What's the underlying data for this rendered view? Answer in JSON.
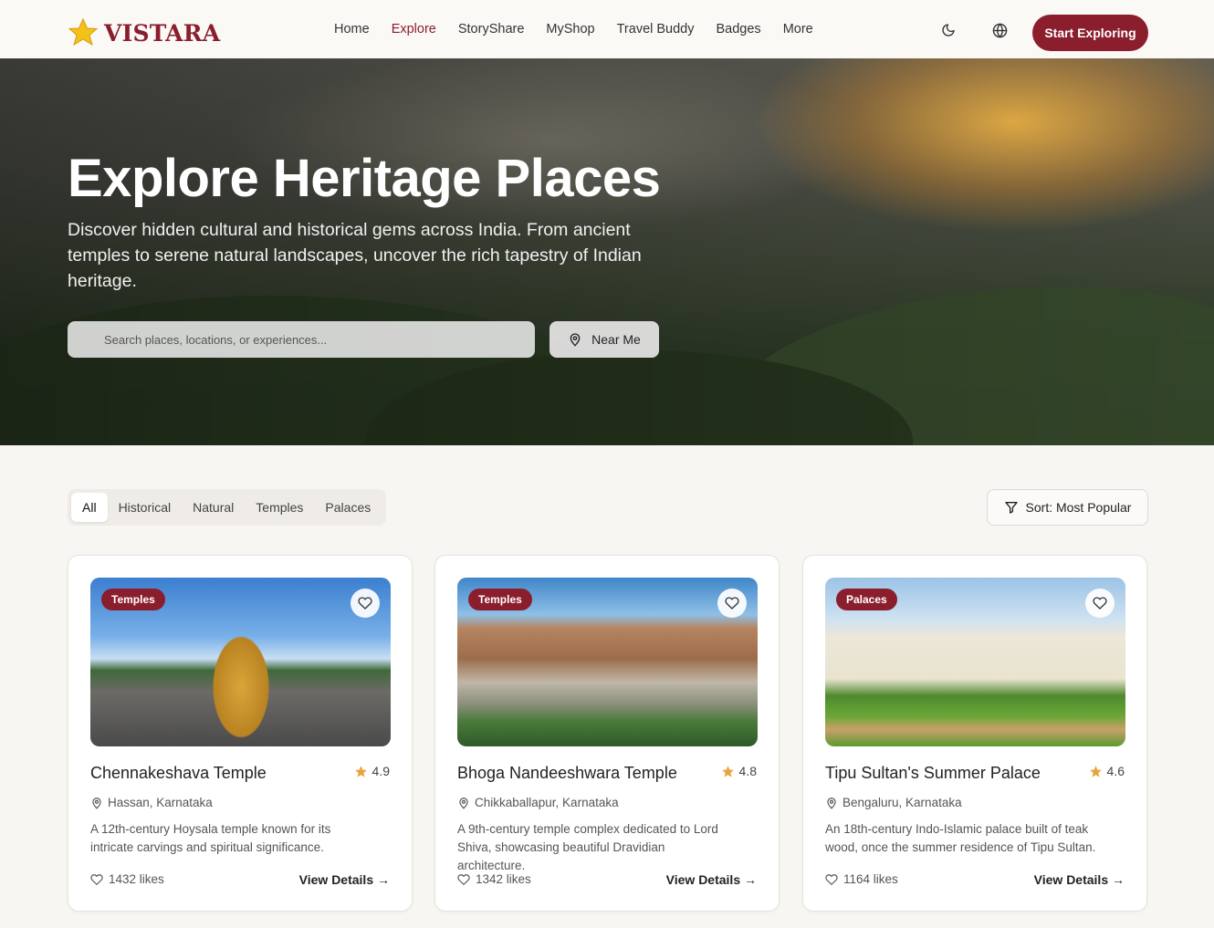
{
  "brand": {
    "name": "VISTARA"
  },
  "nav": {
    "links": [
      "Home",
      "Explore",
      "StoryShare",
      "MyShop",
      "Travel Buddy",
      "Badges",
      "More"
    ],
    "active": "Explore",
    "cta": "Start Exploring"
  },
  "hero": {
    "title": "Explore Heritage Places",
    "subtitle": "Discover hidden cultural and historical gems across India. From ancient temples to serene natural landscapes, uncover the rich tapestry of Indian heritage.",
    "search_placeholder": "Search places, locations, or experiences...",
    "near_me": "Near Me"
  },
  "filters": {
    "tabs": [
      "All",
      "Historical",
      "Natural",
      "Temples",
      "Palaces"
    ],
    "active": "All",
    "sort_label": "Sort: Most Popular"
  },
  "colors": {
    "accent": "#8b1e2d",
    "background": "#f8f6f2",
    "star": "#e8a33d"
  },
  "cards": [
    {
      "category": "Temples",
      "title": "Chennakeshava Temple",
      "rating": "4.9",
      "location": "Hassan, Karnataka",
      "description": "A 12th-century Hoysala temple known for its intricate carvings and spiritual significance.",
      "likes": "1432 likes",
      "cta": "View Details →"
    },
    {
      "category": "Temples",
      "title": "Bhoga Nandeeshwara Temple",
      "rating": "4.8",
      "location": "Chikkaballapur, Karnataka",
      "description": "A 9th-century temple complex dedicated to Lord Shiva, showcasing beautiful Dravidian architecture.",
      "likes": "1342 likes",
      "cta": "View Details →"
    },
    {
      "category": "Palaces",
      "title": "Tipu Sultan's Summer Palace",
      "rating": "4.6",
      "location": "Bengaluru, Karnataka",
      "description": "An 18th-century Indo-Islamic palace built of teak wood, once the summer residence of Tipu Sultan.",
      "likes": "1164 likes",
      "cta": "View Details →"
    }
  ]
}
